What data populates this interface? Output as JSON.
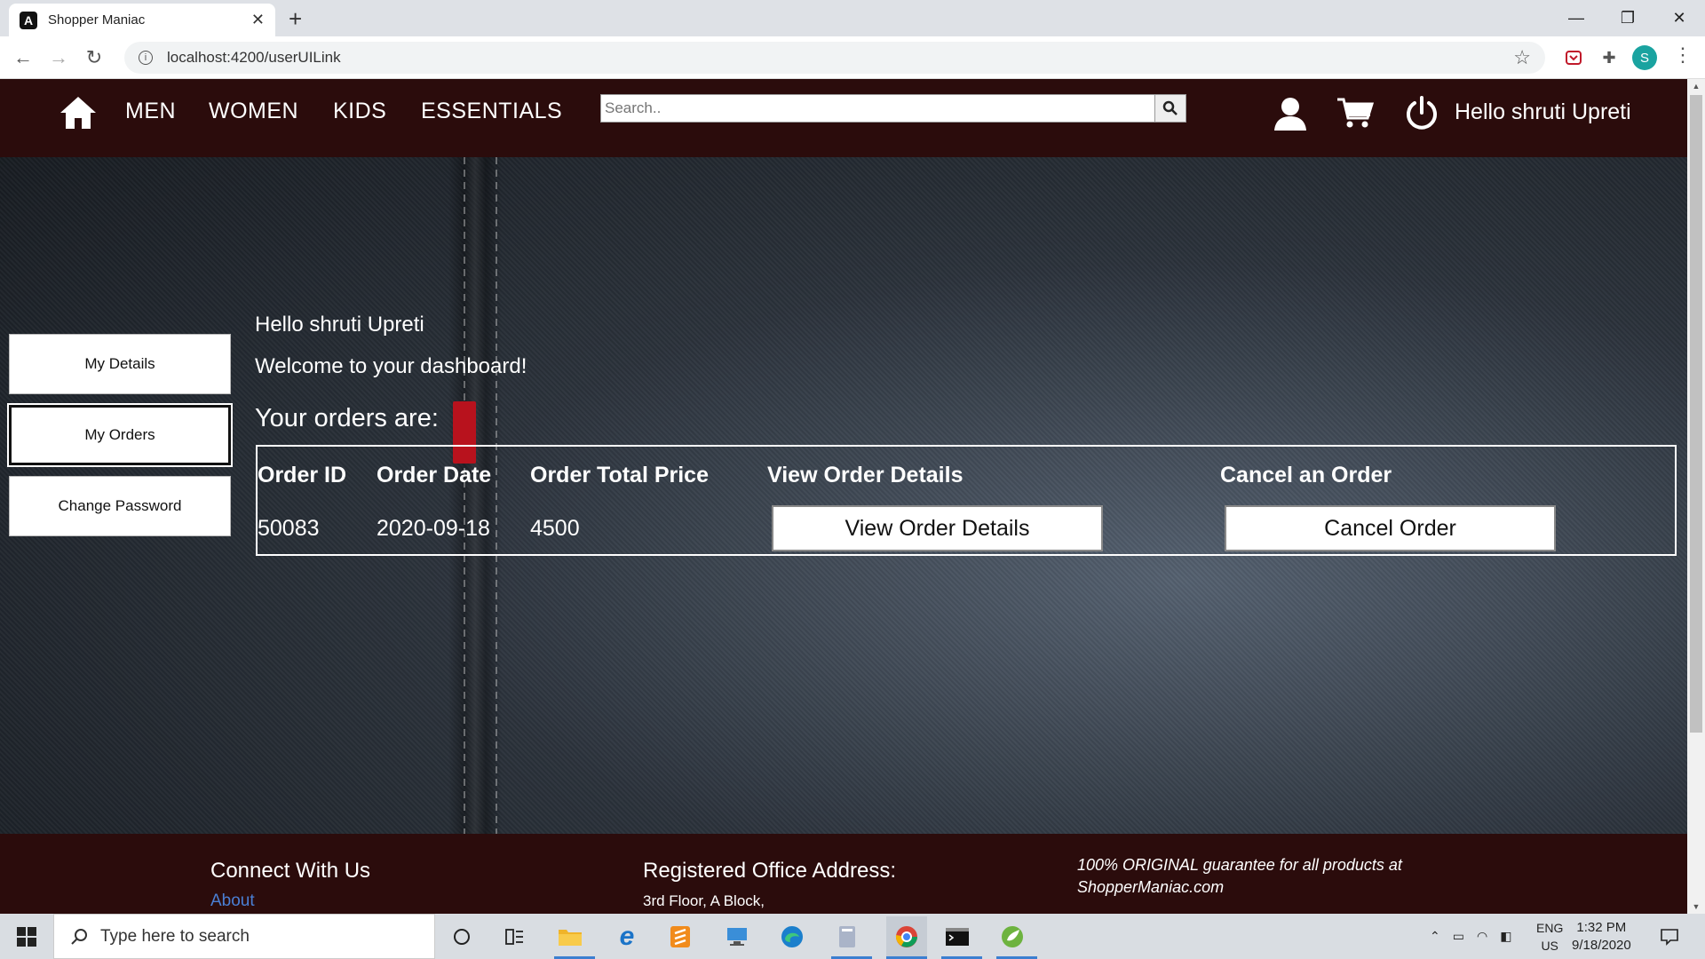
{
  "browser": {
    "tab_title": "Shopper Maniac",
    "url": "localhost:4200/userUILink",
    "profile_initial": "S"
  },
  "navbar": {
    "links": [
      "MEN",
      "WOMEN",
      "KIDS",
      "ESSENTIALS"
    ],
    "search_placeholder": "Search..",
    "greeting": "Hello shruti Upreti",
    "bg_color": "#2b0c0c"
  },
  "sidebar": {
    "items": [
      {
        "label": "My Details",
        "active": false
      },
      {
        "label": "My Orders",
        "active": true
      },
      {
        "label": "Change Password",
        "active": false
      }
    ]
  },
  "dashboard": {
    "greeting": "Hello shruti Upreti",
    "welcome": "Welcome to your dashboard!",
    "orders_heading": "Your orders are:"
  },
  "orders": {
    "headers": [
      "Order ID",
      "Order Date",
      "Order Total Price",
      "View Order Details",
      "Cancel an Order"
    ],
    "rows": [
      {
        "id": "50083",
        "date": "2020-09-18",
        "total": "4500",
        "view_label": "View Order Details",
        "cancel_label": "Cancel Order"
      }
    ]
  },
  "footer": {
    "connect_heading": "Connect With Us",
    "about_link": "About",
    "office_heading": "Registered Office Address:",
    "address_line": "3rd Floor, A Block,",
    "guarantee": "100% ORIGINAL guarantee for all products at ShopperManiac.com"
  },
  "taskbar": {
    "search_placeholder": "Type here to search",
    "lang_1": "ENG",
    "lang_2": "US",
    "time": "1:32 PM",
    "date": "9/18/2020"
  }
}
